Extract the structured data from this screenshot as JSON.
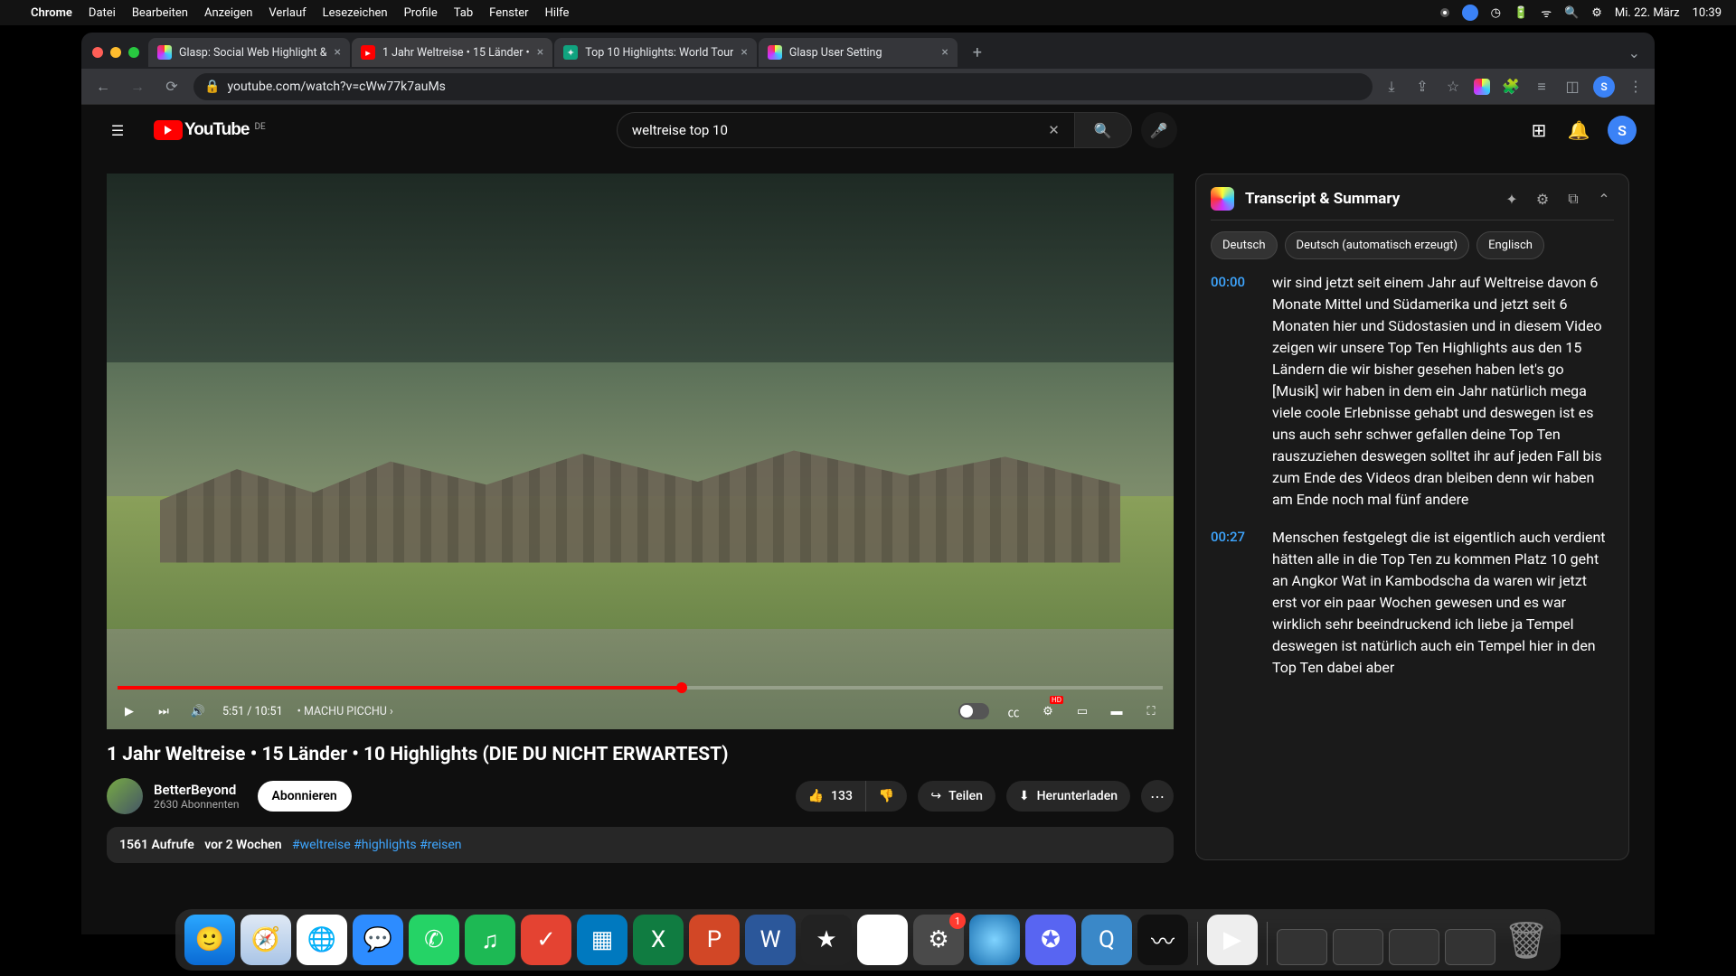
{
  "menubar": {
    "app": "Chrome",
    "items": [
      "Datei",
      "Bearbeiten",
      "Anzeigen",
      "Verlauf",
      "Lesezeichen",
      "Profile",
      "Tab",
      "Fenster",
      "Hilfe"
    ],
    "date": "Mi. 22. März",
    "time": "10:39"
  },
  "tabs": [
    {
      "title": "Glasp: Social Web Highlight &",
      "favicon": "◆"
    },
    {
      "title": "1 Jahr Weltreise • 15 Länder •",
      "favicon": "▶"
    },
    {
      "title": "Top 10 Highlights: World Tour",
      "favicon": "◉"
    },
    {
      "title": "Glasp User Setting",
      "favicon": "◆"
    }
  ],
  "url": "youtube.com/watch?v=cWw77k7auMs",
  "yt": {
    "logo_text": "YouTube",
    "country": "DE",
    "search_value": "weltreise top 10",
    "avatar": "S"
  },
  "player": {
    "current": "5:51",
    "total": "10:51",
    "chapter": "MACHU PICCHU"
  },
  "video": {
    "title": "1 Jahr Weltreise • 15 Länder • 10 Highlights (DIE DU NICHT ERWARTEST)",
    "channel": "BetterBeyond",
    "subs": "2630 Abonnenten",
    "subscribe": "Abonnieren",
    "likes": "133",
    "share": "Teilen",
    "download": "Herunterladen",
    "views": "1561 Aufrufe",
    "age": "vor 2 Wochen",
    "tags": "#weltreise #highlights #reisen"
  },
  "panel": {
    "title": "Transcript & Summary",
    "langs": [
      "Deutsch",
      "Deutsch (automatisch erzeugt)",
      "Englisch"
    ],
    "segments": [
      {
        "ts": "00:00",
        "txt": "wir sind jetzt seit einem Jahr auf Weltreise  davon 6 Monate Mittel und Südamerika und jetzt   seit 6 Monaten hier und Südostasien und  in diesem Video zeigen wir unsere Top Ten   Highlights aus den 15 Ländern die wir  bisher gesehen haben let's go [Musik]   wir haben in dem ein Jahr natürlich mega viele  coole Erlebnisse gehabt und deswegen ist es uns auch sehr schwer gefallen deine Top Ten  rauszuziehen deswegen solltet ihr auf jeden   Fall bis zum Ende des Videos dran bleiben  denn wir haben am Ende noch mal fünf andere"
      },
      {
        "ts": "00:27",
        "txt": "Menschen festgelegt die ist eigentlich auch  verdient hätten alle in die Top Ten zu kommen Platz 10 geht an Angkor Wat in Kambodscha  da waren wir jetzt erst vor ein paar Wochen   gewesen und es war wirklich sehr beeindruckend  ich liebe ja Tempel deswegen ist natürlich auch ein Tempel hier in den Top Ten dabei aber"
      }
    ]
  },
  "dock": {
    "badge": "1"
  }
}
